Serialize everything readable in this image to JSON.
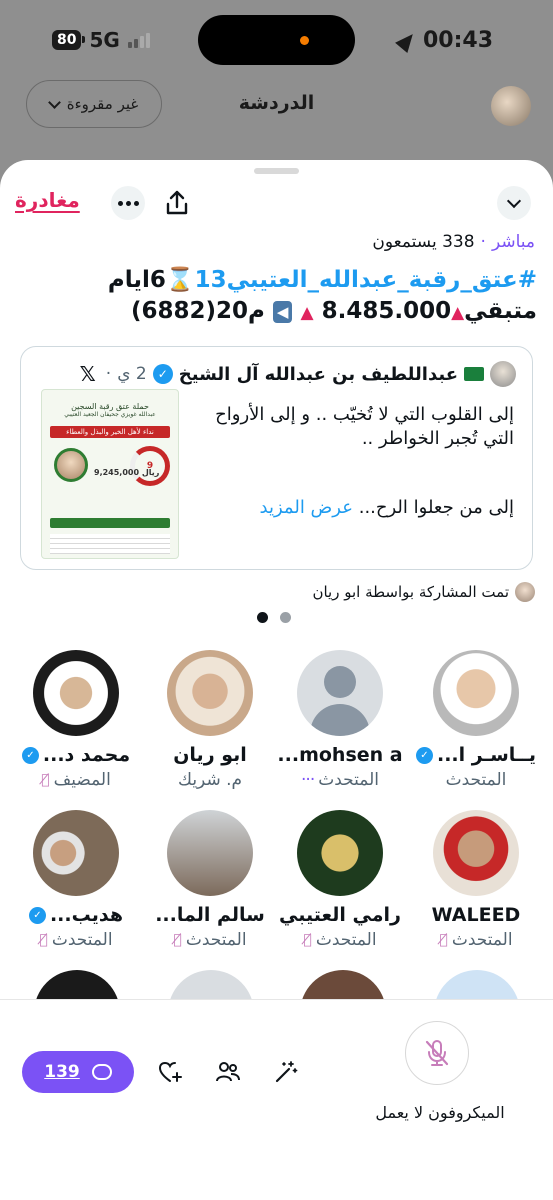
{
  "status_bar": {
    "battery": "80",
    "network": "5G",
    "time": "00:43"
  },
  "behind": {
    "title": "الدردشة",
    "unread_filter": "غير مقروءة"
  },
  "space": {
    "leave_label": "مغادرة",
    "live_label": "مباشر",
    "listeners": "338 يستمعون",
    "title_hashtag": "#عتق_رقبة_عبدالله_العتيبي13",
    "title_rest_1": "6ايام",
    "title_line2_a": "متبقي",
    "title_line2_b": "8.485.000",
    "title_line2_c": "م20(6882)",
    "hourglass": "⌛",
    "arrow": "⬅️"
  },
  "tweet": {
    "author": "عبداللطيف بن عبدالله آل الشيخ",
    "time": "2 ي",
    "platform_icon": "x-logo",
    "text_1": "إلى القلوب التي لا تُخيّب .. و إلى الأرواح التي تُجبر الخواطر ..",
    "text_2": "إلى من جعلوا الرح...",
    "see_more": "عرض المزيد",
    "image": {
      "campaign": "حملة عتق رقبة السجين",
      "prisoner": "عبدالله غويزي جحيفان الجعيد العتيبي",
      "call": "نداء لأهل الخير والبذل والعطاء",
      "remaining_label": "متبقي",
      "days": "9",
      "days_unit": "يوم",
      "amount_label": "المبلغ المتبقي",
      "amount": "9,245,000",
      "currency": "ريال",
      "cta": "ساهم بما تستطع ... لإنقاذ نفس"
    }
  },
  "shared_by": "تمت المشاركة بواسطة ابو ريان",
  "participants": [
    {
      "name": "يــاسـر ا...",
      "role": "المتحدث",
      "verified": true,
      "muted": false
    },
    {
      "name": "mohsen a...",
      "role": "المتحدث",
      "verified": false,
      "muted": false,
      "typing": "···"
    },
    {
      "name": "ابو ريان",
      "role": "م. شريك",
      "verified": false,
      "muted": false
    },
    {
      "name": "محمد د...",
      "role": "المضيف",
      "verified": true,
      "muted": true
    },
    {
      "name": "WALEED",
      "role": "المتحدث",
      "verified": false,
      "muted": true
    },
    {
      "name": "رامي العتيبي",
      "role": "المتحدث",
      "verified": false,
      "muted": true
    },
    {
      "name": "سالم الما...",
      "role": "المتحدث",
      "verified": false,
      "muted": true
    },
    {
      "name": "هديب...",
      "role": "المتحدث",
      "verified": true,
      "muted": true
    }
  ],
  "bottom": {
    "comment_count": "139",
    "mic_label": "الميكروفون لا يعمل"
  },
  "colors": {
    "accent_purple": "#7b52f5",
    "leave_red": "#e0245e",
    "link_blue": "#1d9bf0",
    "muted_pink": "#c77dba"
  }
}
